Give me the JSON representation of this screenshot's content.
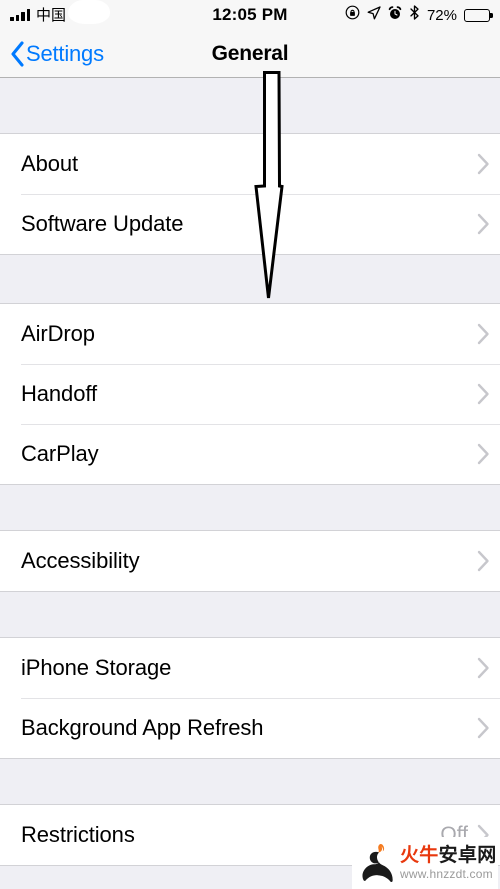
{
  "statusbar": {
    "carrier": "中国",
    "time": "12:05 PM",
    "battery_percent": "72%",
    "battery_level": 72,
    "icons": [
      "signal-bars-icon",
      "wifi-icon",
      "rotation-lock-icon",
      "location-arrow-icon",
      "alarm-clock-icon",
      "bluetooth-icon",
      "battery-icon"
    ]
  },
  "navbar": {
    "back_label": "Settings",
    "title": "General"
  },
  "groups": [
    {
      "rows": [
        {
          "label": "About",
          "value": "",
          "accessory": "chevron"
        },
        {
          "label": "Software Update",
          "value": "",
          "accessory": "chevron"
        }
      ]
    },
    {
      "rows": [
        {
          "label": "AirDrop",
          "value": "",
          "accessory": "chevron"
        },
        {
          "label": "Handoff",
          "value": "",
          "accessory": "chevron"
        },
        {
          "label": "CarPlay",
          "value": "",
          "accessory": "chevron"
        }
      ]
    },
    {
      "rows": [
        {
          "label": "Accessibility",
          "value": "",
          "accessory": "chevron"
        }
      ]
    },
    {
      "rows": [
        {
          "label": "iPhone Storage",
          "value": "",
          "accessory": "chevron"
        },
        {
          "label": "Background App Refresh",
          "value": "",
          "accessory": "chevron"
        }
      ]
    },
    {
      "rows": [
        {
          "label": "Restrictions",
          "value": "Off",
          "accessory": "chevron"
        }
      ]
    }
  ],
  "annotation": {
    "type": "down-arrow",
    "target_row": "About"
  },
  "watermark": {
    "name_red": "火牛",
    "name_black": "安卓网",
    "url": "www.hnzzdt.com"
  },
  "colors": {
    "tint": "#007aff",
    "group_bg": "#efeff4",
    "row_bg": "#ffffff",
    "separator": "#e3e3e6",
    "chevron": "#c7c7cc",
    "value_text": "#a9a9ae",
    "watermark_red": "#e8380d"
  }
}
